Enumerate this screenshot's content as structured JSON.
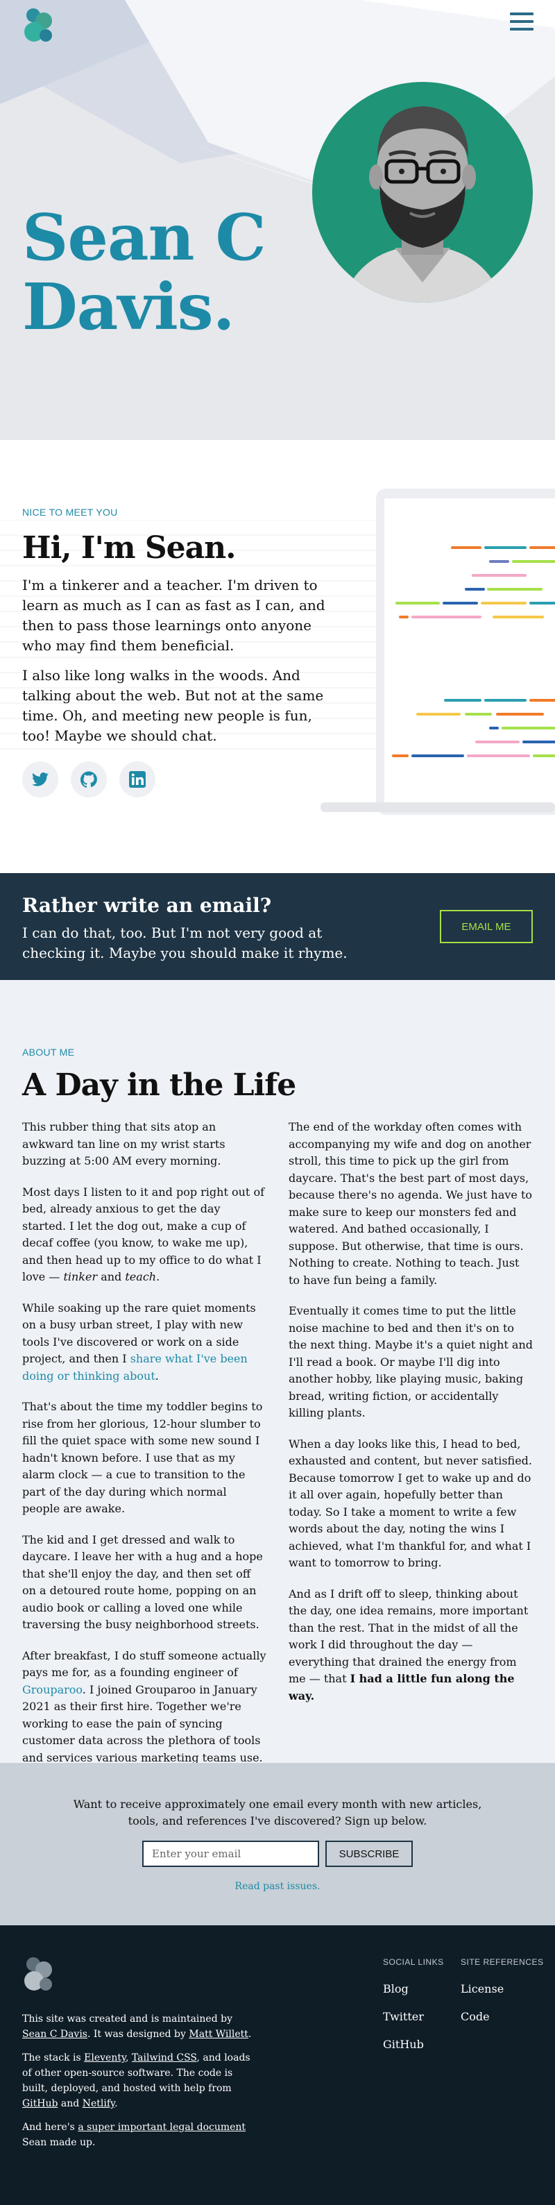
{
  "colors": {
    "accent": "#1d8aa7",
    "dark_navy": "#1f3444",
    "footer_bg": "#0f1d27",
    "lime": "#a6e04a",
    "portrait_green": "#1f9477",
    "about_bg": "#eef1f6"
  },
  "header": {
    "logo_icon": "circles-logo-icon",
    "menu_icon": "hamburger-menu-icon"
  },
  "hero": {
    "name_line1": "Sean C",
    "name_line2": "Davis."
  },
  "intro": {
    "eyebrow": "NICE TO MEET YOU",
    "heading": "Hi, I'm Sean.",
    "paragraph1": "I'm a tinkerer and a teacher. I'm driven to learn as much as I can as fast as I can, and then to pass those learnings onto anyone who may find them beneficial.",
    "paragraph2": "I also like long walks in the woods. And talking about the web. But not at the same time. Oh, and meeting new people is fun, too! Maybe we should chat.",
    "socials": [
      "twitter-icon",
      "github-icon",
      "linkedin-icon"
    ]
  },
  "email_cta": {
    "heading": "Rather write an email?",
    "text": "I can do that, too. But I'm not very good at checking it. Maybe you should make it rhyme.",
    "button": "EMAIL ME"
  },
  "about": {
    "eyebrow": "ABOUT ME",
    "heading": "A Day in the Life",
    "left": {
      "p1": "This rubber thing that sits atop an awkward tan line on my wrist starts buzzing at 5:00 AM every morning.",
      "p2_a": "Most days I listen to it and pop right out of bed, already anxious to get the day started. I let the dog out, make a cup of decaf coffee (you know, to wake me up), and then head up to my office to do what I love — ",
      "p2_em1": "tinker",
      "p2_b": " and ",
      "p2_em2": "teach",
      "p2_c": ".",
      "p3_a": "While soaking up the rare quiet moments on a busy urban street, I play with new tools I've discovered or work on a side project, and then I ",
      "p3_link": "share what I've been doing or thinking about",
      "p3_b": ".",
      "p4": "That's about the time my toddler begins to rise from her glorious, 12-hour slumber to fill the quiet space with some new sound I hadn't known before. I use that as my alarm clock — a cue to transition to the part of the day during which normal people are awake.",
      "p5": "The kid and I get dressed and walk to daycare. I leave her with a hug and a hope that she'll enjoy the day, and then set off on a detoured route home, popping on an audio book or calling a loved one while traversing the busy neighborhood streets.",
      "p6_a": "After breakfast, I do stuff someone actually pays me for, as a founding engineer of ",
      "p6_link": "Grouparoo",
      "p6_b": ". I joined Grouparoo in January 2021 as their first hire. Together we're working to ease the pain of syncing customer data across the plethora of tools and services various marketing teams use."
    },
    "right": {
      "p1": "The end of the workday often comes with accompanying my wife and dog on another stroll, this time to pick up the girl from daycare. That's the best part of most days, because there's no agenda. We just have to make sure to keep our monsters fed and watered. And bathed occasionally, I suppose. But otherwise, that time is ours. Nothing to create. Nothing to teach. Just to have fun being a family.",
      "p2": "Eventually it comes time to put the little noise machine to bed and then it's on to the next thing. Maybe it's a quiet night and I'll read a book. Or maybe I'll dig into another hobby, like playing music, baking bread, writing fiction, or accidentally killing plants.",
      "p3": "When a day looks like this, I head to bed, exhausted and content, but never satisfied. Because tomorrow I get to wake up and do it all over again, hopefully better than today. So I take a moment to write a few words about the day, noting the wins I achieved, what I'm thankful for, and what I want to tomorrow to bring.",
      "p4_a": "And as I drift off to sleep, thinking about the day, one idea remains, more important than the rest. That in the midst of all the work I did throughout the day — everything that drained the energy from me — that ",
      "p4_strong": "I had a little fun along the way."
    }
  },
  "newsletter": {
    "message": "Want to receive approximately one email every month with new articles, tools, and references I've discovered? Sign up below.",
    "placeholder": "Enter your email",
    "button": "SUBSCRIBE",
    "past_link": "Read past issues."
  },
  "footer": {
    "line1_a": "This site was created and is maintained by ",
    "line1_link1": "Sean C Davis",
    "line1_b": ". It was designed by ",
    "line1_link2": "Matt Willett",
    "line1_c": ".",
    "line2_a": "The stack is ",
    "line2_link1": "Eleventy",
    "line2_b": ", ",
    "line2_link2": "Tailwind CSS",
    "line2_c": ", and loads of other open-source software. The code is built, deployed, and hosted with help from ",
    "line2_link3": "GitHub",
    "line2_d": " and ",
    "line2_link4": "Netlify",
    "line2_e": ".",
    "line3_a": "And here's ",
    "line3_link": "a super important legal document",
    "line3_b": " Sean made up.",
    "social_heading": "SOCIAL LINKS",
    "social_links": [
      "Blog",
      "Twitter",
      "GitHub"
    ],
    "ref_heading": "SITE REFERENCES",
    "ref_links": [
      "License",
      "Code"
    ]
  }
}
